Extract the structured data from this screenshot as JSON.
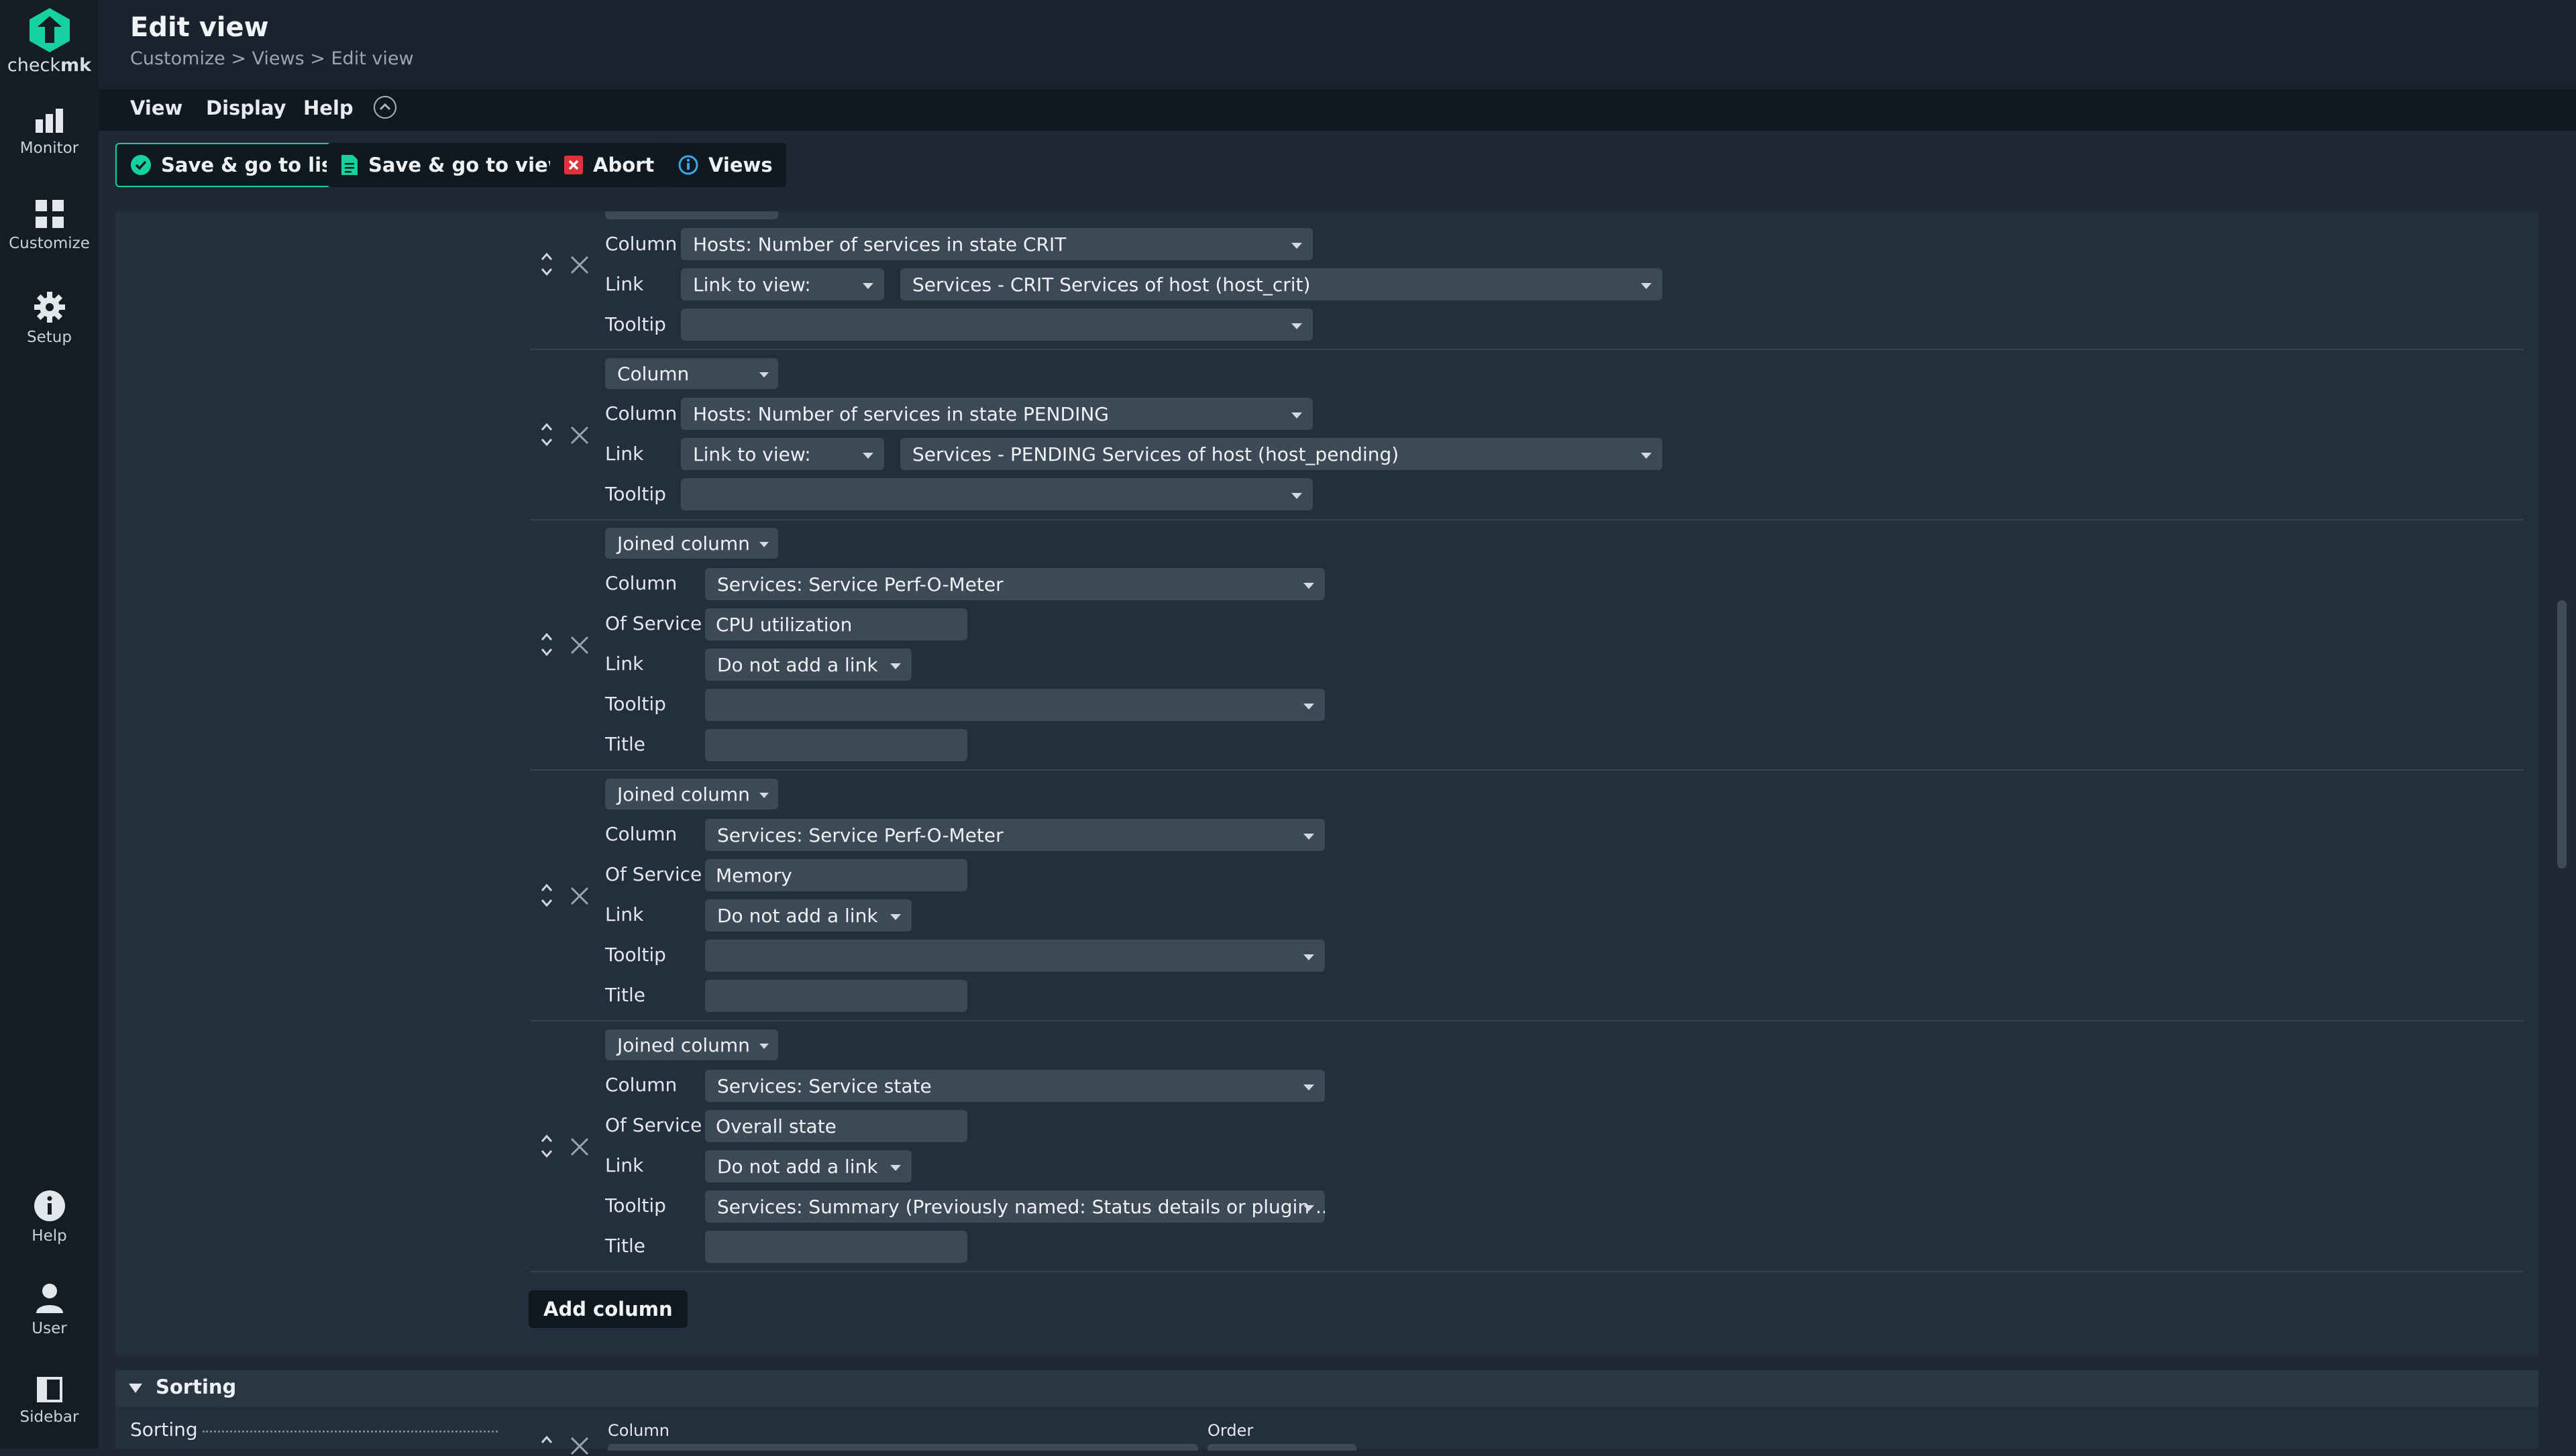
{
  "app": {
    "logo_text_a": "check",
    "logo_text_b": "mk"
  },
  "nav": {
    "monitor": "Monitor",
    "customize": "Customize",
    "setup": "Setup",
    "help": "Help",
    "user": "User",
    "sidebar": "Sidebar"
  },
  "header": {
    "title": "Edit view",
    "breadcrumb": [
      "Customize",
      "Views",
      "Edit view"
    ],
    "breadcrumb_sep": ">"
  },
  "menu": {
    "view": "View",
    "display": "Display",
    "help": "Help"
  },
  "toolbar": {
    "save_list": "Save & go to list",
    "save_view": "Save & go to view",
    "abort": "Abort",
    "views": "Views"
  },
  "columns": [
    {
      "type": "",
      "column": "Hosts: Number of services in state CRIT",
      "link_mode": "Link to view:",
      "link_target": "Services - CRIT Services of host (host_crit)",
      "tooltip": ""
    },
    {
      "type": "Column",
      "column": "Hosts: Number of services in state PENDING",
      "link_mode": "Link to view:",
      "link_target": "Services - PENDING Services of host (host_pending)",
      "tooltip": ""
    },
    {
      "type": "Joined column",
      "column": "Services: Service Perf-O-Meter",
      "of_service": "CPU utilization",
      "link": "Do not add a link",
      "tooltip": "",
      "title": ""
    },
    {
      "type": "Joined column",
      "column": "Services: Service Perf-O-Meter",
      "of_service": "Memory",
      "link": "Do not add a link",
      "tooltip": "",
      "title": ""
    },
    {
      "type": "Joined column",
      "column": "Services: Service state",
      "of_service": "Overall state",
      "link": "Do not add a link",
      "tooltip": "Services: Summary (Previously named: Status details or plugin ...",
      "title": ""
    }
  ],
  "labels": {
    "column": "Column",
    "link": "Link",
    "tooltip": "Tooltip",
    "of_service": "Of Service",
    "title": "Title"
  },
  "add_column": "Add column",
  "sorting": {
    "section_title": "Sorting",
    "label": "Sorting",
    "col_header": "Column",
    "order_header": "Order"
  },
  "colors": {
    "accent": "#15d1a0",
    "abort": "#e0303a",
    "info": "#3aa6f0"
  }
}
